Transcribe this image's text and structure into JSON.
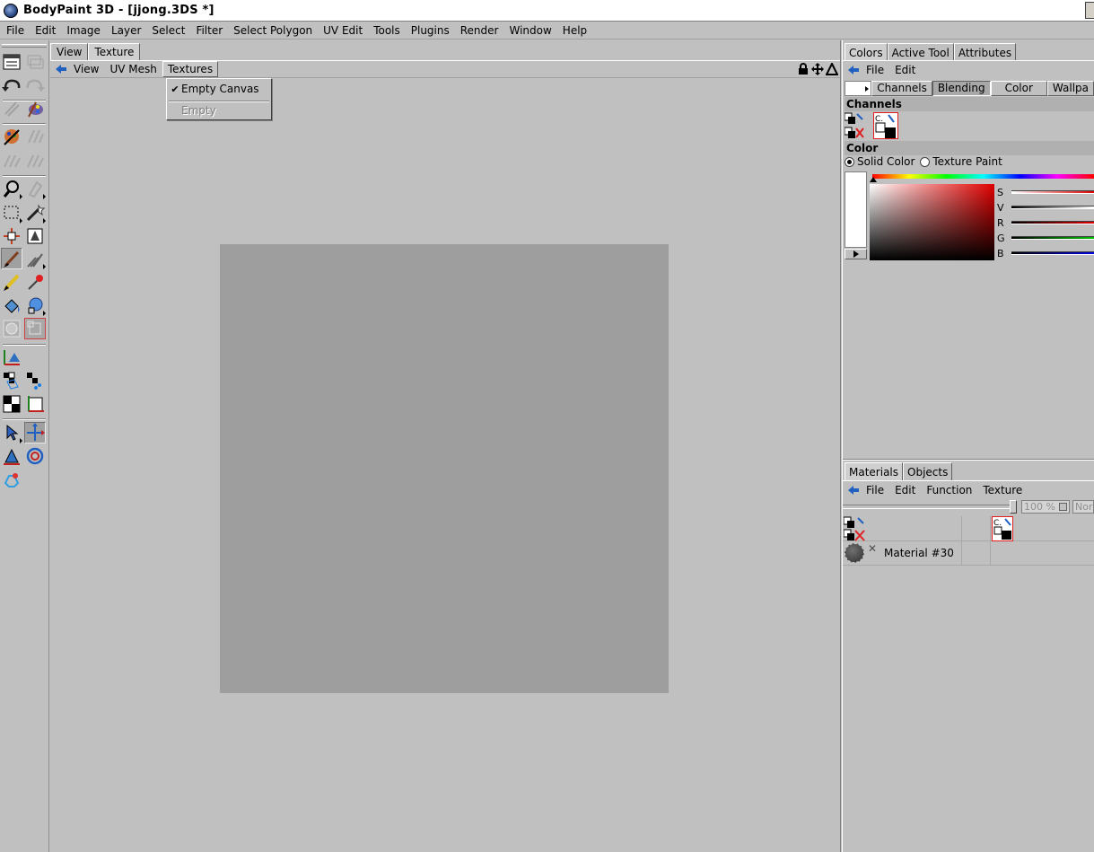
{
  "window": {
    "title": "BodyPaint 3D - [jjong.3DS *]"
  },
  "menubar": [
    "File",
    "Edit",
    "Image",
    "Layer",
    "Select",
    "Filter",
    "Select Polygon",
    "UV Edit",
    "Tools",
    "Plugins",
    "Render",
    "Window",
    "Help"
  ],
  "viewport": {
    "tabs": [
      "View",
      "Texture"
    ],
    "active_tab": "Texture",
    "menu": [
      "View",
      "UV Mesh",
      "Textures"
    ],
    "open_menu": "Textures",
    "dropdown": {
      "items": [
        {
          "label": "Empty Canvas",
          "checked": true,
          "enabled": true
        },
        {
          "label": "Empty",
          "checked": false,
          "enabled": false
        }
      ]
    },
    "canvas_color": "#9e9e9e",
    "right_icons": [
      "lock-icon",
      "move-icon",
      "perspective-icon"
    ]
  },
  "left_toolbar": {
    "icons": [
      "layer-manager-icon",
      "layer-stack-icon",
      "undo-icon",
      "redo-icon",
      "eraser-icon",
      "paint-setup-icon",
      "paint-wizard-icon",
      "brush-symmetry-icon",
      "projection-icon",
      "projection-alt-icon",
      "magnify-icon",
      "clone-icon",
      "rectangle-select-icon",
      "magic-wand-icon",
      "transform-icon",
      "fill-select-icon",
      "brush-icon",
      "smudge-icon",
      "pencil-icon",
      "eyedropper-icon",
      "fill-icon",
      "sponge-icon",
      "circle-shape-icon",
      "polygon-shape-icon",
      "axis-icon",
      "uv-checker-icon",
      "uv-points-icon",
      "checker-icon",
      "uv-move-icon",
      "pointer-icon",
      "uv-transform-icon",
      "uv-rotate-icon",
      "uv-scale-icon",
      "uv-magnet-icon"
    ]
  },
  "colors_panel": {
    "tabs": [
      "Colors",
      "Active Tool",
      "Attributes"
    ],
    "active_tab": "Colors",
    "menu": [
      "File",
      "Edit"
    ],
    "channel_buttons": [
      "Channels",
      "Blending",
      "Color",
      "Wallpa"
    ],
    "active_channel_button": "Blending",
    "channels_title": "Channels",
    "color_title": "Color",
    "radio_solid": "Solid Color",
    "radio_texture": "Texture Paint",
    "solid_selected": true,
    "slider_labels": [
      "S",
      "V",
      "R",
      "G",
      "B"
    ],
    "slider_colors": [
      "#e00000",
      "#202020",
      "#c00000",
      "#00a000",
      "#0000c0"
    ]
  },
  "materials_panel": {
    "tabs": [
      "Materials",
      "Objects"
    ],
    "active_tab": "Materials",
    "menu": [
      "File",
      "Edit",
      "Function",
      "Texture"
    ],
    "zoom": "100 %",
    "blend_mode": "Nor",
    "material_name": "Material #30"
  }
}
